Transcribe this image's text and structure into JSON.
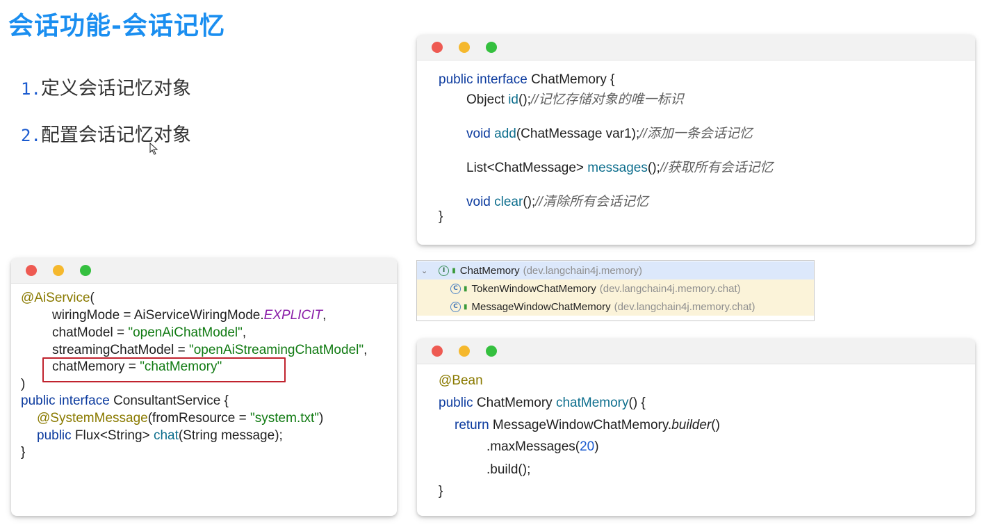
{
  "title": "会话功能-会话记忆",
  "steps": [
    {
      "num": "1.",
      "text": "定义会话记忆对象"
    },
    {
      "num": "2.",
      "text": "配置会话记忆对象"
    }
  ],
  "interface_code": {
    "l1_kw": "public interface",
    "l1_name": " ChatMemory {",
    "l2_a": "Object ",
    "l2_fn": "id",
    "l2_b": "();",
    "l2_cm": "//记忆存储对象的唯一标识",
    "l3_kw": "void ",
    "l3_fn": "add",
    "l3_b": "(ChatMessage var1);",
    "l3_cm": "//添加一条会话记忆",
    "l4_a": "List<ChatMessage> ",
    "l4_fn": "messages",
    "l4_b": "();",
    "l4_cm": "//获取所有会话记忆",
    "l5_kw": "void ",
    "l5_fn": "clear",
    "l5_b": "();",
    "l5_cm": "//清除所有会话记忆",
    "l6": "}"
  },
  "tree": {
    "root_icon": "I",
    "root_name": "ChatMemory",
    "root_pkg": "(dev.langchain4j.memory)",
    "child1_icon": "C",
    "child1_name": "TokenWindowChatMemory",
    "child1_pkg": "(dev.langchain4j.memory.chat)",
    "child2_icon": "C",
    "child2_name": "MessageWindowChatMemory",
    "child2_pkg": "(dev.langchain4j.memory.chat)"
  },
  "service_code": {
    "l1_ann": "@AiService",
    "l1_b": "(",
    "l2_a": "wiringMode = AiServiceWiringMode.",
    "l2_enum": "EXPLICIT",
    "l2_b": ",",
    "l3_a": "chatModel = ",
    "l3_str": "\"openAiChatModel\"",
    "l3_b": ",",
    "l4_a": "streamingChatModel = ",
    "l4_str": "\"openAiStreamingChatModel\"",
    "l4_b": ",",
    "l5_a": "chatMemory = ",
    "l5_str": "\"chatMemory\"",
    "l6": ")",
    "l7_kw": "public interface",
    "l7_b": " ConsultantService {",
    "l8_ann": "@SystemMessage",
    "l8_a": "(fromResource = ",
    "l8_str": "\"system.txt\"",
    "l8_b": ")",
    "l9_kw": "public",
    "l9_a": " Flux<String> ",
    "l9_fn": "chat",
    "l9_b": "(String message);",
    "l10": "}"
  },
  "bean_code": {
    "l1_ann": "@Bean",
    "l2_kw": "public",
    "l2_a": " ChatMemory ",
    "l2_fn": "chatMemory",
    "l2_b": "() {",
    "l3_kw": "return",
    "l3_a": " MessageWindowChatMemory.",
    "l3_it": "builder",
    "l3_b": "()",
    "l4_a": ".maxMessages(",
    "l4_num": "20",
    "l4_b": ")",
    "l5": ".build();",
    "l6": "}"
  },
  "colors": {
    "title": "#1a8ef0",
    "keyword": "#0b3a9e",
    "string": "#107a12",
    "annotation": "#8a7a00",
    "highlight_box": "#c0232e"
  }
}
